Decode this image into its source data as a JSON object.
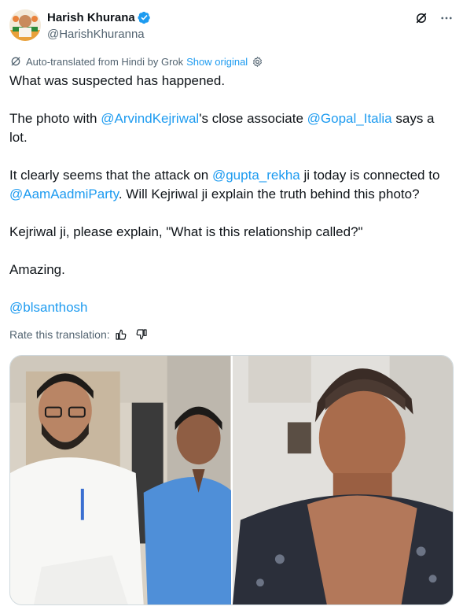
{
  "tweet": {
    "author": {
      "display_name": "Harish Khurana",
      "handle": "@HarishKhuranna",
      "verified": true,
      "verified_color": "#1d9bf0"
    },
    "translation_notice": {
      "text": "Auto-translated from Hindi by Grok",
      "show_original": "Show original"
    },
    "body": {
      "line1": "What was suspected has happened.",
      "p2_a": "The photo with ",
      "p2_m1": "@ArvindKejriwal",
      "p2_b": "'s close associate ",
      "p2_m2": "@Gopal_Italia",
      "p2_c": " says a lot.",
      "p3_a": "It clearly seems that the attack on ",
      "p3_m1": "@gupta_rekha",
      "p3_b": " ji today is connected to ",
      "p3_m2": "@AamAadmiParty",
      "p3_c": ". Will Kejriwal ji explain the truth behind this photo?",
      "p4": "Kejriwal ji, please explain, \"What is this relationship called?\"",
      "p5": "Amazing.",
      "p6_m": "@blsanthosh"
    },
    "rate_translation": "Rate this translation:",
    "media": {
      "count": 2
    }
  },
  "colors": {
    "accent": "#1d9bf0",
    "text": "#0f1419",
    "muted": "#536471",
    "border": "#cfd9de"
  },
  "icons": [
    "verified-badge-icon",
    "grok-icon",
    "more-icon",
    "translate-icon",
    "settings-icon",
    "thumbs-up-icon",
    "thumbs-down-icon"
  ]
}
